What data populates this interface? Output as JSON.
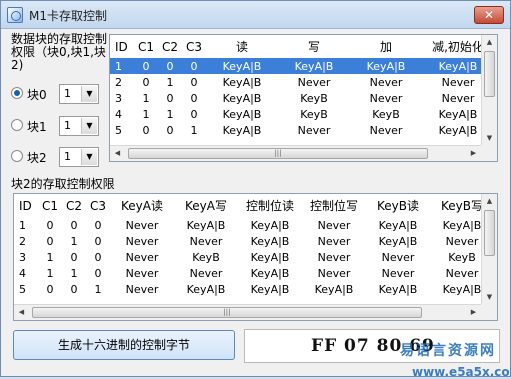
{
  "window": {
    "title": "M1卡存取控制",
    "close_glyph": "✕"
  },
  "description": "数据块的存取控制权限（块0,块1,块2)",
  "blocks": [
    {
      "label": "块0",
      "value": "1",
      "checked": true
    },
    {
      "label": "块1",
      "value": "1",
      "checked": false
    },
    {
      "label": "块2",
      "value": "1",
      "checked": false
    }
  ],
  "data_table": {
    "headers": [
      "ID",
      "C1",
      "C2",
      "C3",
      "读",
      "写",
      "加",
      "减,初始化"
    ],
    "rows": [
      [
        "1",
        "0",
        "0",
        "0",
        "KeyA|B",
        "KeyA|B",
        "KeyA|B",
        "KeyA|B"
      ],
      [
        "2",
        "0",
        "1",
        "0",
        "KeyA|B",
        "Never",
        "Never",
        "Never"
      ],
      [
        "3",
        "1",
        "0",
        "0",
        "KeyA|B",
        "KeyB",
        "Never",
        "Never"
      ],
      [
        "4",
        "1",
        "1",
        "0",
        "KeyA|B",
        "KeyB",
        "KeyB",
        "KeyA|B"
      ],
      [
        "5",
        "0",
        "0",
        "1",
        "KeyA|B",
        "Never",
        "Never",
        "KeyA|B"
      ]
    ]
  },
  "section2_label": "块2的存取控制权限",
  "trailer_table": {
    "headers": [
      "ID",
      "C1",
      "C2",
      "C3",
      "KeyA读",
      "KeyA写",
      "控制位读",
      "控制位写",
      "KeyB读",
      "KeyB写"
    ],
    "rows": [
      [
        "1",
        "0",
        "0",
        "0",
        "Never",
        "KeyA|B",
        "KeyA|B",
        "Never",
        "KeyA|B",
        "KeyA|B"
      ],
      [
        "2",
        "0",
        "1",
        "0",
        "Never",
        "Never",
        "KeyA|B",
        "Never",
        "KeyA|B",
        "Never"
      ],
      [
        "3",
        "1",
        "0",
        "0",
        "Never",
        "KeyB",
        "KeyA|B",
        "Never",
        "Never",
        "KeyB"
      ],
      [
        "4",
        "1",
        "1",
        "0",
        "Never",
        "Never",
        "KeyA|B",
        "Never",
        "Never",
        "Never"
      ],
      [
        "5",
        "0",
        "0",
        "1",
        "Never",
        "KeyA|B",
        "KeyA|B",
        "KeyA|B",
        "KeyA|B",
        "KeyA|B"
      ]
    ]
  },
  "scroll_glyphs": {
    "up": "▲",
    "down": "▼",
    "left": "◀",
    "right": "▶",
    "grip": "|||",
    "drop": "▼"
  },
  "generate_button": "生成十六进制的控制字节",
  "output_value": "FF 07 80 69",
  "watermark": {
    "top": "易语言资源网",
    "bottom": "www.e5a5x.com"
  },
  "colors": {
    "selection": "#3b7fd9",
    "watermark": "#1b68b8",
    "close": "#c24b34"
  }
}
